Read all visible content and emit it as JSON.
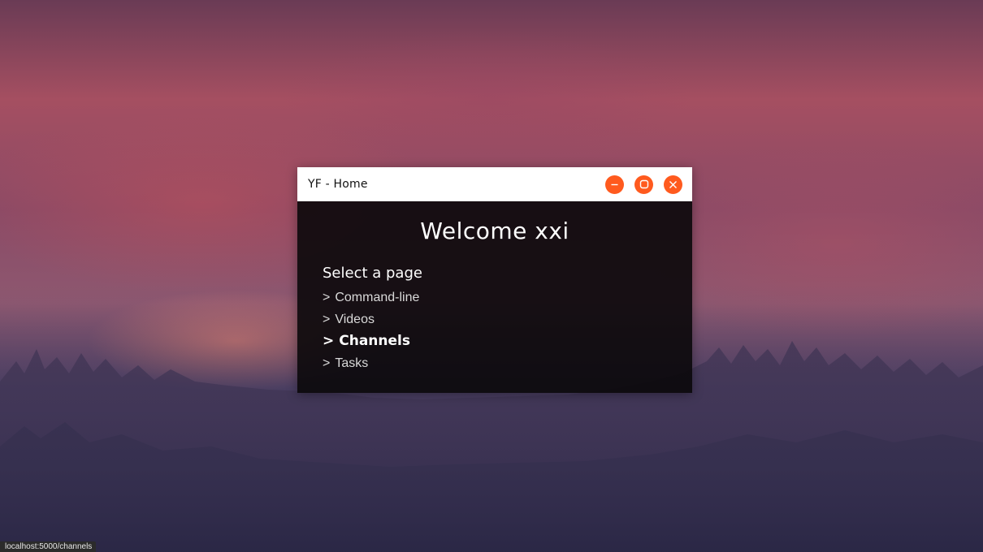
{
  "window": {
    "title": "YF - Home",
    "controls": {
      "minimize_icon": "minus-circle-icon",
      "maximize_icon": "square-circle-icon",
      "close_icon": "x-circle-icon",
      "color": "#ff5a1e"
    }
  },
  "main": {
    "welcome": "Welcome xxi",
    "select_label": "Select a page",
    "nav": [
      {
        "arrow": ">",
        "label": "Command-line",
        "active": false
      },
      {
        "arrow": ">",
        "label": "Videos",
        "active": false
      },
      {
        "arrow": ">",
        "label": "Channels",
        "active": true
      },
      {
        "arrow": ">",
        "label": "Tasks",
        "active": false
      }
    ]
  },
  "status_bar": {
    "url": "localhost:5000/channels"
  }
}
